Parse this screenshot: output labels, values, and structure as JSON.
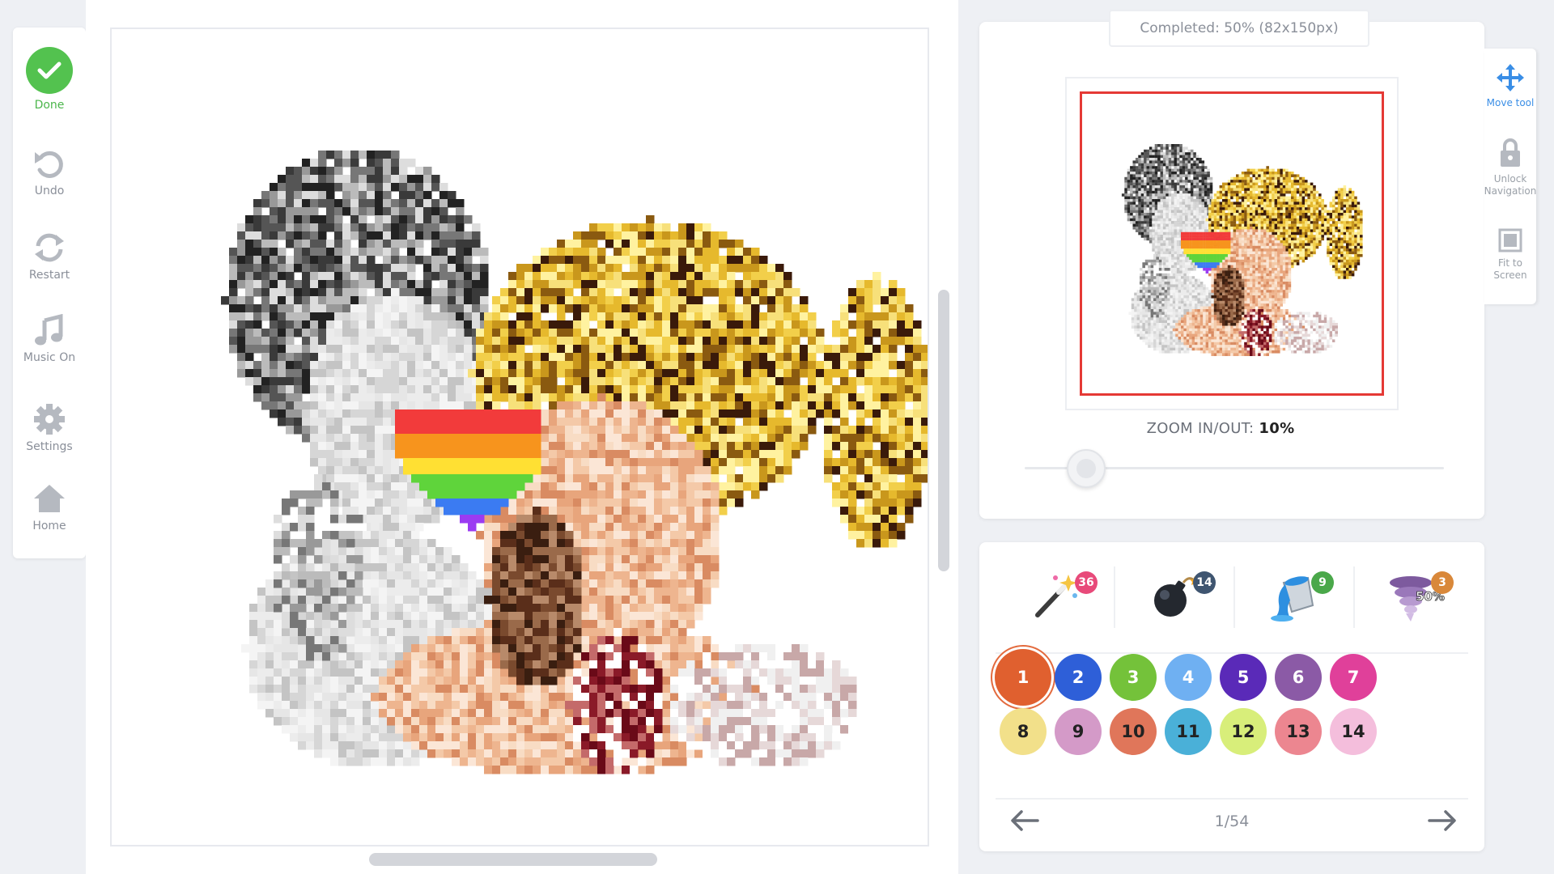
{
  "left_toolbar": {
    "done": "Done",
    "undo": "Undo",
    "restart": "Restart",
    "music": "Music On",
    "settings": "Settings",
    "home": "Home"
  },
  "preview": {
    "completed": "Completed: 50% (82x150px)",
    "zoom_label": "ZOOM IN/OUT:",
    "zoom_value": "10%",
    "zoom_level": 0.1
  },
  "right_tools": {
    "move": "Move tool",
    "unlock": "Unlock Navigation",
    "fit": "Fit to Screen"
  },
  "boosters": [
    {
      "name": "magic-wand",
      "count": "36",
      "badge_color": "#e84a7a"
    },
    {
      "name": "bomb",
      "count": "14",
      "badge_color": "#3f5570"
    },
    {
      "name": "paint-bucket",
      "count": "9",
      "badge_color": "#4aa84a"
    },
    {
      "name": "tornado",
      "count": "3",
      "badge_color": "#d9883a",
      "overlay": "50%"
    }
  ],
  "palette": [
    {
      "num": "1",
      "color": "#e0602f",
      "text": "#ffffff",
      "selected": true
    },
    {
      "num": "2",
      "color": "#2e5fd8",
      "text": "#ffffff"
    },
    {
      "num": "3",
      "color": "#74c23a",
      "text": "#ffffff"
    },
    {
      "num": "4",
      "color": "#6fb0f2",
      "text": "#ffffff"
    },
    {
      "num": "5",
      "color": "#5a2ab8",
      "text": "#ffffff"
    },
    {
      "num": "6",
      "color": "#8b5aa6",
      "text": "#ffffff"
    },
    {
      "num": "7",
      "color": "#e0409a",
      "text": "#ffffff"
    },
    {
      "num": "8",
      "color": "#f2e08a",
      "text": "#222222"
    },
    {
      "num": "9",
      "color": "#d49ac8",
      "text": "#222222"
    },
    {
      "num": "10",
      "color": "#e0765a",
      "text": "#222222"
    },
    {
      "num": "11",
      "color": "#4ab0d8",
      "text": "#222222"
    },
    {
      "num": "12",
      "color": "#d8ee7a",
      "text": "#222222"
    },
    {
      "num": "13",
      "color": "#ec8690",
      "text": "#222222"
    },
    {
      "num": "14",
      "color": "#f4bedc",
      "text": "#222222"
    }
  ],
  "pager": {
    "text": "1/54"
  },
  "colors": {
    "done_green": "#53c24f",
    "accent_blue": "#3a8ee6",
    "viewport_red": "#e53935"
  }
}
